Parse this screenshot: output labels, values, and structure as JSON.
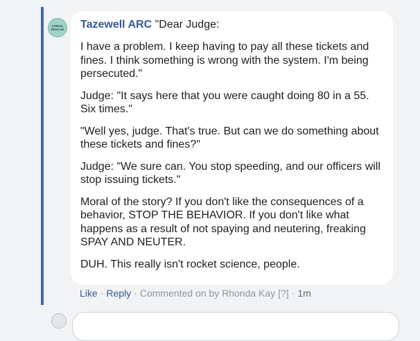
{
  "comment": {
    "avatar_text": "ANIMAL RESCUE",
    "author": "Tazewell ARC",
    "first_line": " \"Dear Judge:",
    "paragraphs": [
      "I have a problem. I keep having to pay all these tickets and fines. I think something is wrong with the system. I'm being persecuted.\"",
      "Judge: \"It says here that you were caught doing 80 in a 55. Six times.\"",
      "\"Well yes, judge. That's true. But can we do something about these tickets and fines?\"",
      "Judge: \"We sure can. You stop speeding, and our officers will stop issuing tickets.\"",
      "Moral of the story? If you don't like the consequences of a behavior, STOP THE BEHAVIOR. If you don't like what happens as a result of not spaying and neutering, freaking SPAY AND NEUTER.",
      "DUH. This really isn't rocket science, people."
    ]
  },
  "actions": {
    "like": "Like",
    "reply": "Reply",
    "commented_on": "Commented on by Rhonda Kay",
    "help": "[?]",
    "time": "1m"
  },
  "colors": {
    "author": "#385898",
    "thread_bar": "#4267b2",
    "background": "#f2f3f5",
    "bubble": "#ffffff"
  }
}
